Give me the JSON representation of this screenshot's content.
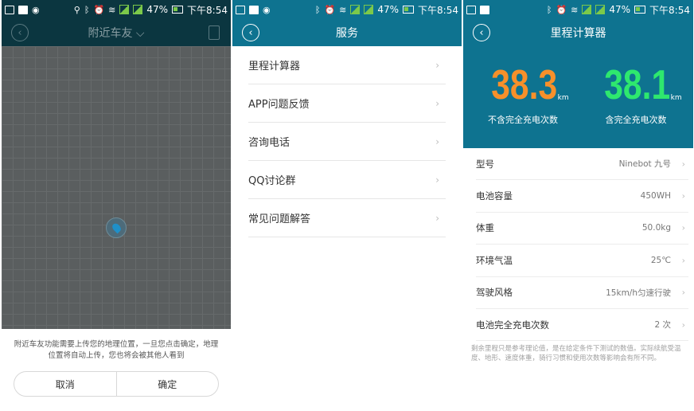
{
  "status": {
    "battery_pct": "47%",
    "time": "下午8:54",
    "signal_label": "2G"
  },
  "screen1": {
    "title": "附近车友",
    "title_caret": "⌵",
    "back_icon": "chevron-left",
    "message": "附近车友功能需要上传您的地理位置，一旦您点击确定，地理位置将自动上传，您也将会被其他人看到",
    "cancel_label": "取消",
    "confirm_label": "确定"
  },
  "screen2": {
    "title": "服务",
    "items": [
      {
        "label": "里程计算器"
      },
      {
        "label": "APP问题反馈"
      },
      {
        "label": "咨询电话"
      },
      {
        "label": "QQ讨论群"
      },
      {
        "label": "常见问题解答"
      }
    ],
    "chevron": "›"
  },
  "screen3": {
    "title": "里程计算器",
    "stat_left": {
      "value": "38.3",
      "unit": "km",
      "caption": "不含完全充电次数",
      "color": "#f7902a"
    },
    "stat_right": {
      "value": "38.1",
      "unit": "km",
      "caption": "含完全充电次数",
      "color": "#2ee86e"
    },
    "rows": [
      {
        "label": "型号",
        "value": "Ninebot 九号"
      },
      {
        "label": "电池容量",
        "value": "450WH"
      },
      {
        "label": "体重",
        "value": "50.0kg"
      },
      {
        "label": "环境气温",
        "value": "25℃"
      },
      {
        "label": "驾驶风格",
        "value": "15km/h匀速行驶"
      },
      {
        "label": "电池完全充电次数",
        "value": "2 次"
      }
    ],
    "note": "剩余里程只是参考理论值，是在给定条件下测试的数值。实际续航受温度、地形、速度体重，骑行习惯和使用次数等影响会有所不同。"
  },
  "colors": {
    "header_teal": "#0e7390",
    "header_dark": "#0b3640",
    "accent_orange": "#f7902a",
    "accent_green": "#2ee86e"
  }
}
